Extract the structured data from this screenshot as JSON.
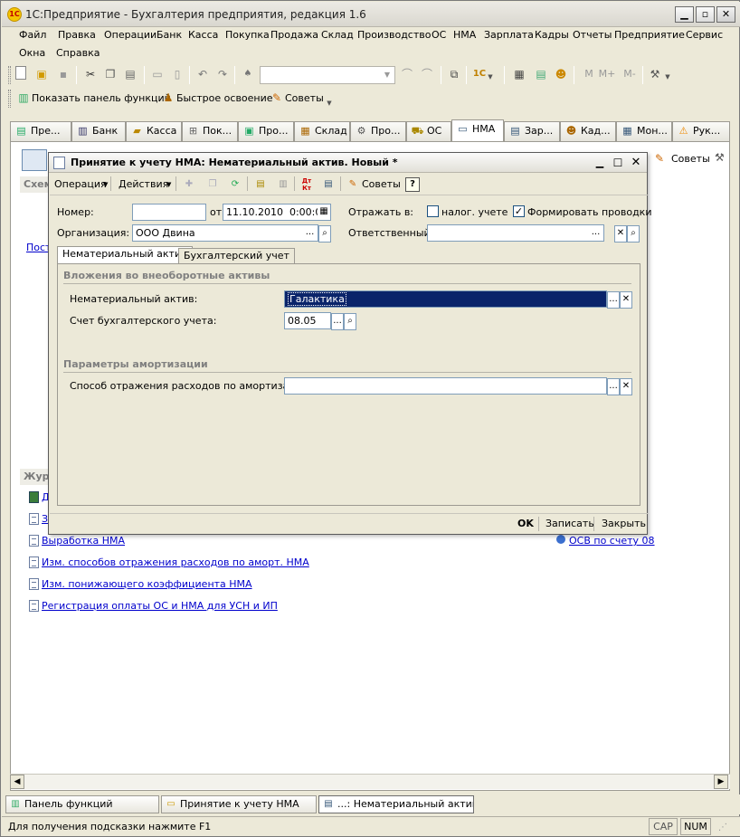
{
  "app": {
    "title": "1С:Предприятие - Бухгалтерия предприятия, редакция 1.6",
    "logo": "1С"
  },
  "menu": {
    "row1": [
      "Файл",
      "Правка",
      "Операции",
      "Банк",
      "Касса",
      "Покупка",
      "Продажа",
      "Склад",
      "Производство",
      "ОС",
      "НМА",
      "Зарплата",
      "Кадры",
      "Отчеты",
      "Предприятие",
      "Сервис"
    ],
    "row2": [
      "Окна",
      "Справка"
    ]
  },
  "toolbar2": {
    "functions_panel": "Показать панель функций",
    "quick_learning": "Быстрое освоение",
    "tips": "Советы"
  },
  "toolbar1": {
    "m": "M",
    "mplus": "M+",
    "mminus": "M-"
  },
  "tabs": [
    {
      "label": "Пре...",
      "icon": "enterprise-icon"
    },
    {
      "label": "Банк",
      "icon": "bank-icon"
    },
    {
      "label": "Касса",
      "icon": "cash-icon"
    },
    {
      "label": "Пок...",
      "icon": "purchase-icon"
    },
    {
      "label": "Про...",
      "icon": "sales-icon"
    },
    {
      "label": "Склад",
      "icon": "warehouse-icon"
    },
    {
      "label": "Про...",
      "icon": "production-icon"
    },
    {
      "label": "ОС",
      "icon": "fixed-assets-icon"
    },
    {
      "label": "НМА",
      "icon": "intangible-icon"
    },
    {
      "label": "Зар...",
      "icon": "salary-icon"
    },
    {
      "label": "Кад...",
      "icon": "hr-icon"
    },
    {
      "label": "Мон...",
      "icon": "monitor-icon"
    },
    {
      "label": "Рук...",
      "icon": "warning-icon"
    }
  ],
  "panel": {
    "scheme_header": "Схем",
    "tips_button": "Советы",
    "journals_header": "Жур",
    "left_link": "Пост",
    "links": [
      {
        "label": "Д",
        "icon": "journal-icon"
      },
      {
        "label": "З",
        "icon": "doc-icon"
      },
      {
        "label": "Выработка НМА",
        "icon": "doc-icon"
      },
      {
        "label": "Изм. способов отражения расходов по аморт. НМА",
        "icon": "doc-icon"
      },
      {
        "label": "Изм. понижающего коэффициента НМА",
        "icon": "doc-icon"
      },
      {
        "label": "Регистрация оплаты ОС и НМА для УСН и ИП",
        "icon": "doc-icon"
      }
    ],
    "report_link": "ОСВ по счету 08"
  },
  "dialog": {
    "title": "Принятие к учету НМА: Нематериальный актив. Новый *",
    "toolbar": {
      "operation": "Операция",
      "actions": "Действия",
      "tips": "Советы",
      "help": "?"
    },
    "header": {
      "number_label": "Номер:",
      "number_value": "",
      "date_label": "от:",
      "date_value": "11.10.2010  0:00:00",
      "reflect_label": "Отражать в:",
      "tax_label": "налог. учете",
      "tax_checked": false,
      "postings_label": "Формировать проводки",
      "postings_checked": true,
      "org_label": "Организация:",
      "org_value": "ООО Двина",
      "responsible_label": "Ответственный:",
      "responsible_value": ""
    },
    "inner_tabs": [
      "Нематериальный актив",
      "Бухгалтерский учет"
    ],
    "group1": {
      "title": "Вложения во внеоборотные активы",
      "asset_label": "Нематериальный актив:",
      "asset_value": "Галактика",
      "account_label": "Счет бухгалтерского учета:",
      "account_value": "08.05"
    },
    "group2": {
      "title": "Параметры амортизации",
      "method_label": "Способ отражения расходов по амортизации:",
      "method_value": ""
    },
    "footer": {
      "ok": "OK",
      "save": "Записать",
      "close": "Закрыть"
    }
  },
  "taskbar": [
    {
      "label": "Панель функций",
      "icon": "panel-icon",
      "active": false
    },
    {
      "label": "Принятие к учету НМА",
      "icon": "folder-icon",
      "active": false
    },
    {
      "label": "...: Нематериальный актив....",
      "icon": "doc-icon",
      "active": true
    }
  ],
  "status": {
    "hint": "Для получения подсказки нажмите F1",
    "cap": "CAP",
    "num": "NUM"
  }
}
